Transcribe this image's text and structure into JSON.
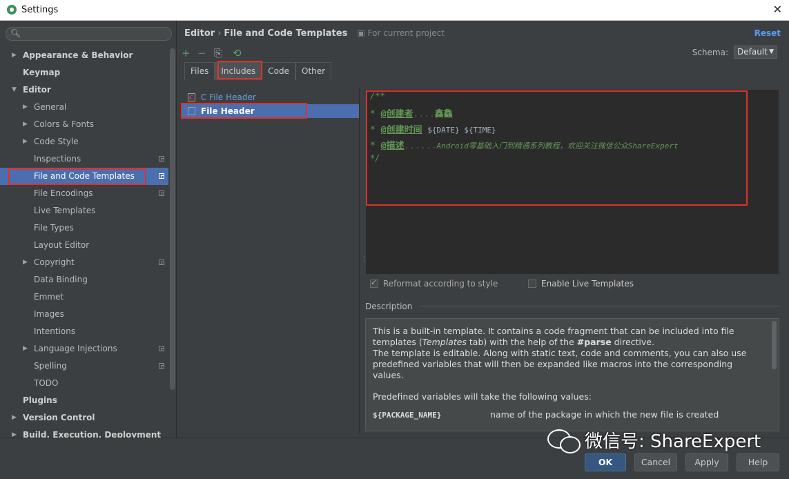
{
  "window": {
    "title": "Settings",
    "close_glyph": "✕"
  },
  "search": {
    "placeholder": ""
  },
  "tree": [
    {
      "label": "Appearance & Behavior",
      "level": 0,
      "arrow": "▶",
      "bold": true
    },
    {
      "label": "Keymap",
      "level": 0,
      "arrow": "",
      "bold": true
    },
    {
      "label": "Editor",
      "level": 0,
      "arrow": "▼",
      "bold": true
    },
    {
      "label": "General",
      "level": 1,
      "arrow": "▶"
    },
    {
      "label": "Colors & Fonts",
      "level": 1,
      "arrow": "▶"
    },
    {
      "label": "Code Style",
      "level": 1,
      "arrow": "▶"
    },
    {
      "label": "Inspections",
      "level": 1,
      "arrow": "",
      "project": true
    },
    {
      "label": "File and Code Templates",
      "level": 1,
      "arrow": "",
      "project": true,
      "selected": true
    },
    {
      "label": "File Encodings",
      "level": 1,
      "arrow": "",
      "project": true
    },
    {
      "label": "Live Templates",
      "level": 1,
      "arrow": ""
    },
    {
      "label": "File Types",
      "level": 1,
      "arrow": ""
    },
    {
      "label": "Layout Editor",
      "level": 1,
      "arrow": ""
    },
    {
      "label": "Copyright",
      "level": 1,
      "arrow": "▶",
      "project": true
    },
    {
      "label": "Data Binding",
      "level": 1,
      "arrow": ""
    },
    {
      "label": "Emmet",
      "level": 1,
      "arrow": ""
    },
    {
      "label": "Images",
      "level": 1,
      "arrow": ""
    },
    {
      "label": "Intentions",
      "level": 1,
      "arrow": ""
    },
    {
      "label": "Language Injections",
      "level": 1,
      "arrow": "▶",
      "project": true
    },
    {
      "label": "Spelling",
      "level": 1,
      "arrow": "",
      "project": true
    },
    {
      "label": "TODO",
      "level": 1,
      "arrow": ""
    },
    {
      "label": "Plugins",
      "level": 0,
      "arrow": "",
      "bold": true
    },
    {
      "label": "Version Control",
      "level": 0,
      "arrow": "▶",
      "bold": true
    },
    {
      "label": "Build, Execution, Deployment",
      "level": 0,
      "arrow": "▶",
      "bold": true
    }
  ],
  "header": {
    "crumb_parent": "Editor",
    "crumb_sep": "›",
    "crumb_current": "File and Code Templates",
    "project_note": "For current project",
    "reset_label": "Reset"
  },
  "toolbar": {
    "add": "+",
    "remove": "−",
    "copy": "⎘",
    "reset_default": "⟲"
  },
  "schema": {
    "label": "Schema:",
    "value": "Default",
    "arrow": "▼"
  },
  "tabs": [
    "Files",
    "Includes",
    "Code",
    "Other"
  ],
  "templates": [
    {
      "label": "C File Header",
      "type": "c"
    },
    {
      "label": "File Header",
      "type": "plain",
      "selected": true
    }
  ],
  "editor": {
    "line1": "/**",
    "line2_star": "* ",
    "line2_tag": "@创建者",
    "line2_dots": "....",
    "line2_value": "鑫鱻",
    "line3_star": "* ",
    "line3_tag": "@创建时间",
    "line3_value": "${DATE} ${TIME}",
    "line4_star": "* ",
    "line4_tag": "@描述",
    "line4_dots": "......",
    "line4_value": "Android零基础入门到精通系列教程，欢迎关注微信公众ShareExpert",
    "line5": "*/"
  },
  "options": {
    "reformat": {
      "label": "Reformat according to style",
      "checked": true
    },
    "live_templates": {
      "label": "Enable Live Templates",
      "checked": false
    }
  },
  "description": {
    "title": "Description",
    "p1_a": "This is a built-in template. It contains a code fragment that can be included into file templates (",
    "p1_em": "Templates",
    "p1_b": " tab) with the help of the ",
    "p1_strong": "#parse",
    "p1_c": " directive.",
    "p2": "The template is editable. Along with static text, code and comments, you can also use predefined variables that will then be expanded like macros into the corresponding values.",
    "p3": "Predefined variables will take the following values:",
    "var1_name": "${PACKAGE_NAME}",
    "var1_desc": "name of the package in which the new file is created"
  },
  "buttons": {
    "ok": "OK",
    "cancel": "Cancel",
    "apply": "Apply",
    "help": "Help"
  },
  "watermark": {
    "text": "微信号: ShareExpert"
  }
}
